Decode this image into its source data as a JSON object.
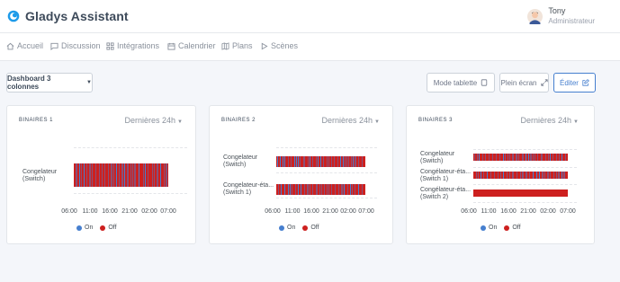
{
  "app": {
    "title": "Gladys Assistant",
    "user": {
      "name": "Tony",
      "role": "Administrateur"
    }
  },
  "nav": [
    {
      "label": "Accueil",
      "icon": "home-icon"
    },
    {
      "label": "Discussion",
      "icon": "message-square-icon"
    },
    {
      "label": "Intégrations",
      "icon": "grid-icon"
    },
    {
      "label": "Calendrier",
      "icon": "calendar-icon"
    },
    {
      "label": "Plans",
      "icon": "map-icon"
    },
    {
      "label": "Scènes",
      "icon": "play-icon"
    }
  ],
  "toolbar": {
    "dashboard_select": "Dashboard 3 colonnes",
    "tablet_mode": "Mode tablette",
    "fullscreen": "Plein écran",
    "edit": "Éditer"
  },
  "colors": {
    "on": "#467fcf",
    "off": "#cd201f",
    "accent": "#467fcf"
  },
  "cards": [
    {
      "title": "BINAIRES 1",
      "range": "Dernières 24h",
      "rows": [
        {
          "label": [
            "Congelateur",
            "(Switch)"
          ]
        }
      ],
      "ticks": [
        "06:00",
        "11:00",
        "16:00",
        "21:00",
        "02:00",
        "07:00"
      ],
      "legend": {
        "on": "On",
        "off": "Off"
      }
    },
    {
      "title": "BINAIRES 2",
      "range": "Dernières 24h",
      "rows": [
        {
          "label": [
            "Congelateur",
            "(Switch)"
          ]
        },
        {
          "label": [
            "Congelateur-éta...",
            "(Switch 1)"
          ]
        }
      ],
      "ticks": [
        "06:00",
        "11:00",
        "16:00",
        "21:00",
        "02:00",
        "07:00"
      ],
      "legend": {
        "on": "On",
        "off": "Off"
      }
    },
    {
      "title": "BINAIRES 3",
      "range": "Dernières 24h",
      "rows": [
        {
          "label": [
            "Congelateur",
            "(Switch)"
          ]
        },
        {
          "label": [
            "Congélateur-éta...",
            "(Switch 1)"
          ]
        },
        {
          "label": [
            "Congélateur-éta...",
            "(Switch 2)"
          ]
        }
      ],
      "ticks": [
        "06:00",
        "11:00",
        "16:00",
        "21:00",
        "02:00",
        "07:00"
      ],
      "legend": {
        "on": "On",
        "off": "Off"
      }
    }
  ]
}
